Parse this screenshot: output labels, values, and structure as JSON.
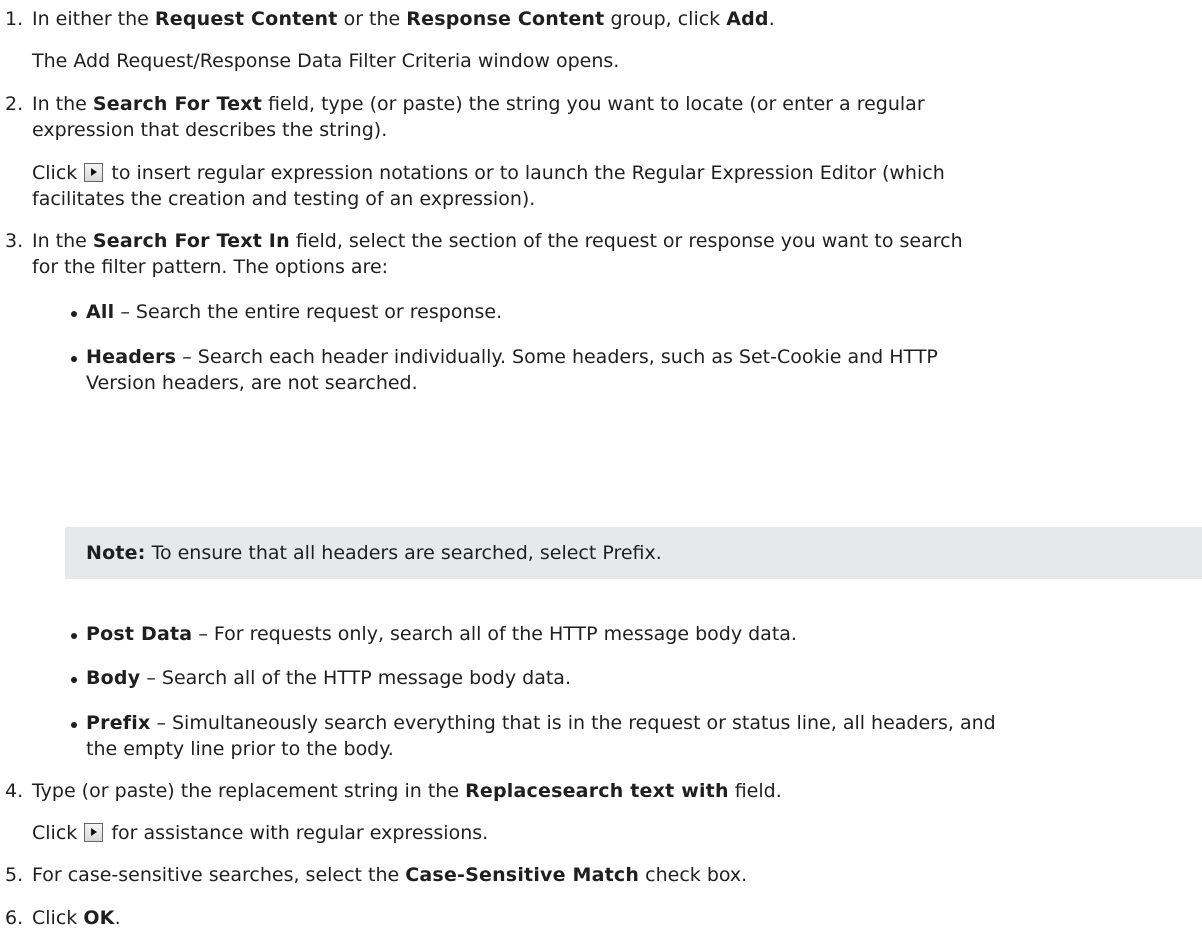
{
  "steps": [
    {
      "number": "1.",
      "text_a": "In either the ",
      "bold_a": "Request Content",
      "text_b": " or the ",
      "bold_b": "Response Content",
      "text_c": " group, click ",
      "bold_c": "Add",
      "text_d": ".",
      "follow": "The Add Request/Response Data Filter Criteria window opens."
    },
    {
      "number": "2.",
      "text_a": "In the ",
      "bold_a": "Search For Text",
      "text_b": " field, type (or paste) the string you want to locate (or enter a regular",
      "text_c": "expression that describes the string).",
      "click_a": "Click ",
      "click_b": " to insert regular expression notations or to launch the Regular Expression Editor (which",
      "click_c": "facilitates the creation and testing of an expression)."
    },
    {
      "number": "3.",
      "text_a": "In the ",
      "bold_a": "Search For Text In",
      "text_b": " field, select the section of the request or response you want to search",
      "text_c": "for the filter pattern. The options are:",
      "options": [
        {
          "label": "All",
          "desc": " – Search the entire request or response."
        },
        {
          "label": "Headers",
          "desc": " – Search each header individually. Some headers, such as Set-Cookie and HTTP",
          "desc2": "Version headers, are not searched."
        },
        {
          "label": "Post Data",
          "desc": " – For requests only, search all of the HTTP message body data."
        },
        {
          "label": "Body",
          "desc": " – Search all of the HTTP message body data."
        },
        {
          "label": "Prefix",
          "desc": " – Simultaneously search everything that is in the request or status line, all headers, and",
          "desc2": "the empty line prior to the body."
        }
      ],
      "note_label": "Note:",
      "note_text": " To ensure that all headers are searched, select Prefix."
    },
    {
      "number": "4.",
      "text_a": "Type (or paste) the replacement string in the ",
      "bold_a": "Replacesearch text with",
      "text_b": " field.",
      "click_a": "Click ",
      "click_b": " for assistance with regular expressions."
    },
    {
      "number": "5.",
      "text_a": "For case-sensitive searches, select the ",
      "bold_a": "Case-Sensitive Match",
      "text_b": " check box."
    },
    {
      "number": "6.",
      "text_a": "Click ",
      "bold_a": "OK",
      "text_b": "."
    }
  ],
  "icons": {
    "expand_button": "play-arrow-icon"
  }
}
